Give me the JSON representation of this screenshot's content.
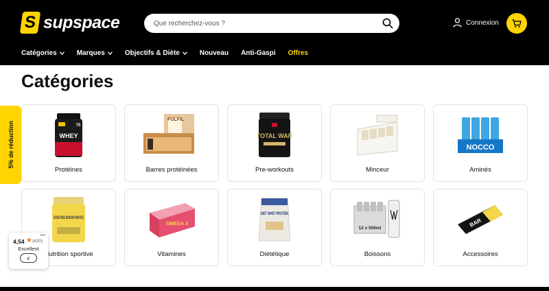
{
  "header": {
    "brand": "supspace",
    "brand_mark": "S",
    "search_placeholder": "Que recherchez-vous ?",
    "login_label": "Connexion"
  },
  "nav": {
    "items": [
      {
        "label": "Catégories",
        "has_dropdown": true
      },
      {
        "label": "Marques",
        "has_dropdown": true
      },
      {
        "label": "Objectifs & Diète",
        "has_dropdown": true
      },
      {
        "label": "Nouveau",
        "has_dropdown": false
      },
      {
        "label": "Anti-Gaspi",
        "has_dropdown": false
      },
      {
        "label": "Offres",
        "has_dropdown": false
      }
    ]
  },
  "page": {
    "title": "Catégories"
  },
  "categories": [
    {
      "label": "Protéines",
      "image": "protein-tub",
      "image_text": "WHEY",
      "badge": "75"
    },
    {
      "label": "Barres protéinées",
      "image": "protein-bar-box",
      "image_text": "FULFIL"
    },
    {
      "label": "Pre-workouts",
      "image": "preworkout-tub",
      "image_text": "TOTAL WAR"
    },
    {
      "label": "Minceur",
      "image": "bar-display-box",
      "image_text": ""
    },
    {
      "label": "Aminés",
      "image": "cans-pack",
      "image_text": "NOCCO"
    },
    {
      "label": "Nutrition sportive",
      "image": "creatine-tub",
      "image_text": "CREATINE MONOHYDRATE"
    },
    {
      "label": "Vitamines",
      "image": "omega-box",
      "image_text": "OMEGA 3"
    },
    {
      "label": "Diététique",
      "image": "protein-pouch",
      "image_text": "DIET WHEY PROTEIN"
    },
    {
      "label": "Boissons",
      "image": "energy-cans",
      "image_text": "12 x 500ml"
    },
    {
      "label": "Accessoires",
      "image": "protein-bar",
      "image_text": "BAR"
    }
  ],
  "promo": {
    "label": "5% de réduction"
  },
  "rating_widget": {
    "score": "4,54",
    "count": "(630)",
    "label": "Excellent",
    "badge": "e"
  },
  "colors": {
    "header_bg": "#000000",
    "accent": "#ffd400",
    "star": "#f07a1a"
  }
}
